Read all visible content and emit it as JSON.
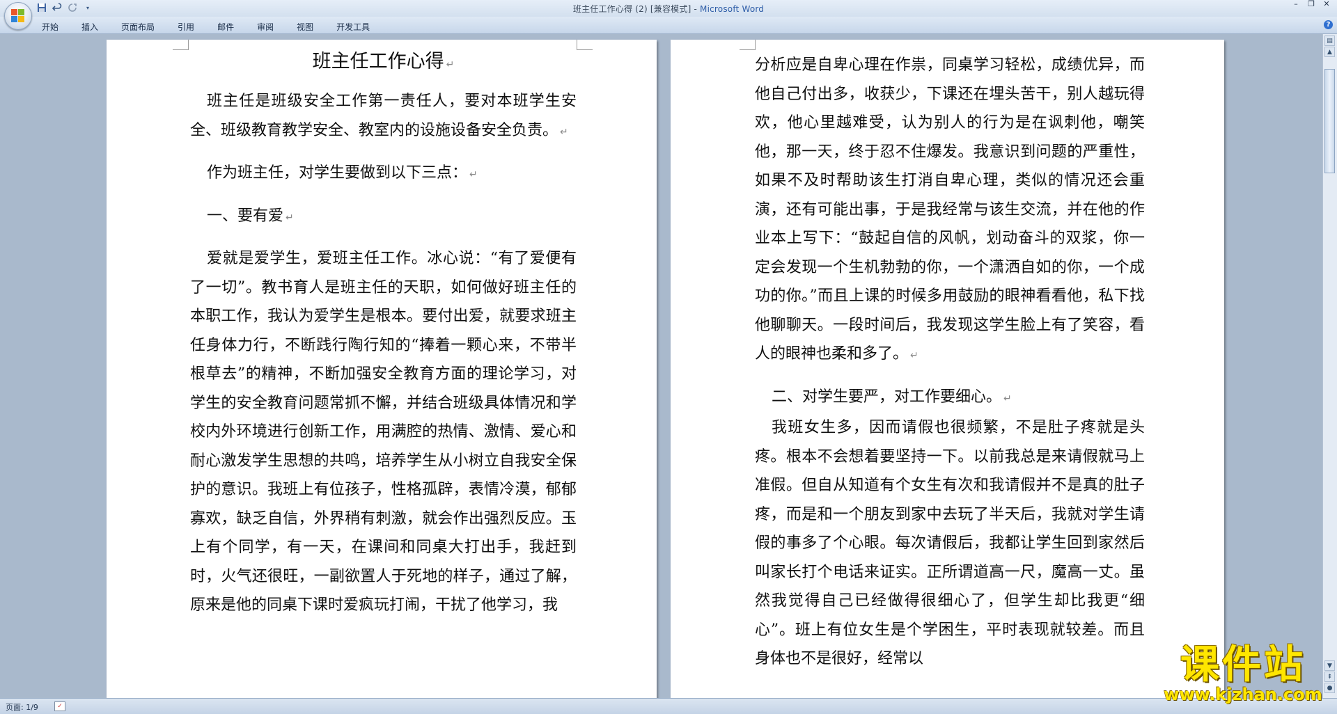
{
  "window": {
    "title": "班主任工作心得 (2) [兼容模式] - ",
    "app_name": "Microsoft Word",
    "minimize": "–",
    "restore": "❐",
    "close": "✕"
  },
  "quick_access": {
    "save_icon": "save-icon",
    "undo_icon": "undo-icon",
    "redo_icon": "redo-icon",
    "customize_icon": "dropdown-icon"
  },
  "ribbon": {
    "tabs": [
      "开始",
      "插入",
      "页面布局",
      "引用",
      "邮件",
      "审阅",
      "视图",
      "开发工具"
    ],
    "help": "?"
  },
  "document": {
    "left_page": {
      "title": "班主任工作心得",
      "paragraphs": [
        "班主任是班级安全工作第一责任人，要对本班学生安全、班级教育教学安全、教室内的设施设备安全负责。",
        "作为班主任，对学生要做到以下三点：",
        "一、要有爱",
        "爱就是爱学生，爱班主任工作。冰心说：“有了爱便有了一切”。教书育人是班主任的天职，如何做好班主任的本职工作，我认为爱学生是根本。要付出爱，就要求班主任身体力行，不断践行陶行知的“捧着一颗心来，不带半根草去”的精神，不断加强安全教育方面的理论学习，对学生的安全教育问题常抓不懈，并结合班级具体情况和学校内外环境进行创新工作，用满腔的热情、激情、爱心和耐心激发学生思想的共鸣，培养学生从小树立自我安全保护的意识。我班上有位孩子，性格孤辟，表情冷漠，郁郁寡欢，缺乏自信，外界稍有刺激，就会作出强烈反应。玉上有个同学，有一天，在课间和同桌大打出手，我赶到时，火气还很旺，一副欲置人于死地的样子，通过了解，原来是他的同桌下课时爱疯玩打闹，干扰了他学习，我"
      ]
    },
    "right_page": {
      "paragraphs": [
        "分析应是自卑心理在作祟，同桌学习轻松，成绩优异，而他自己付出多，收获少，下课还在埋头苦干，别人越玩得欢，他心里越难受，认为别人的行为是在讽刺他，嘲笑他，那一天，终于忍不住爆发。我意识到问题的严重性，如果不及时帮助该生打消自卑心理，类似的情况还会重演，还有可能出事，于是我经常与该生交流，并在他的作业本上写下：“鼓起自信的风帆，划动奋斗的双浆，你一定会发现一个生机勃勃的你，一个潇洒自如的你，一个成功的你。”而且上课的时候多用鼓励的眼神看看他，私下找他聊聊天。一段时间后，我发现这学生脸上有了笑容，看人的眼神也柔和多了。",
        "二、对学生要严，对工作要细心。",
        "我班女生多，因而请假也很频繁，不是肚子疼就是头疼。根本不会想着要坚持一下。以前我总是来请假就马上准假。但自从知道有个女生有次和我请假并不是真的肚子疼，而是和一个朋友到家中去玩了半天后，我就对学生请假的事多了个心眼。每次请假后，我都让学生回到家然后叫家长打个电话来证实。正所谓道高一尺，魔高一丈。虽然我觉得自己已经做得很细心了，但学生却比我更“细心”。班上有位女生是个学困生，平时表现就较差。而且身体也不是很好，经常以"
      ]
    },
    "paragraph_mark": "↵"
  },
  "status_bar": {
    "page_info": "页面: 1/9",
    "proofing_icon": "spellcheck-icon"
  },
  "watermark": {
    "title": "课件站",
    "url": "www.kjzhan.com"
  }
}
